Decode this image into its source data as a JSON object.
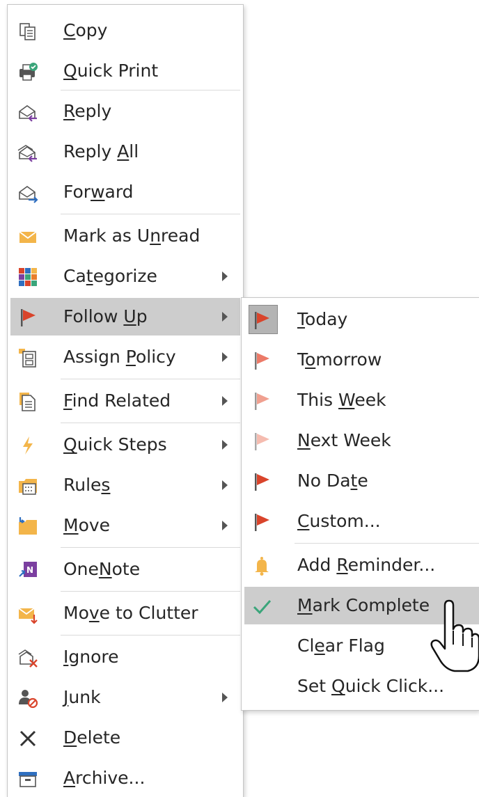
{
  "menu": {
    "items": [
      {
        "label": "Copy",
        "ul": 0,
        "icon": "copy-icon",
        "submenu": false,
        "highlighted": false
      },
      {
        "label": "Quick Print",
        "ul": 0,
        "icon": "quick-print-icon",
        "submenu": false,
        "highlighted": false
      },
      {
        "label": "Reply",
        "ul": 0,
        "icon": "reply-icon",
        "submenu": false,
        "highlighted": false
      },
      {
        "label": "Reply All",
        "ul": 6,
        "icon": "reply-all-icon",
        "submenu": false,
        "highlighted": false
      },
      {
        "label": "Forward",
        "ul": 3,
        "icon": "forward-icon",
        "submenu": false,
        "highlighted": false
      },
      {
        "label": "Mark as Unread",
        "ul": 9,
        "icon": "mark-unread-icon",
        "submenu": false,
        "highlighted": false
      },
      {
        "label": "Categorize",
        "ul": 2,
        "icon": "categorize-icon",
        "submenu": true,
        "highlighted": false
      },
      {
        "label": "Follow Up",
        "ul": 7,
        "icon": "follow-up-flag-icon",
        "submenu": true,
        "highlighted": true
      },
      {
        "label": "Assign Policy",
        "ul": 7,
        "icon": "assign-policy-icon",
        "submenu": true,
        "highlighted": false
      },
      {
        "label": "Find Related",
        "ul": 0,
        "icon": "find-related-icon",
        "submenu": true,
        "highlighted": false
      },
      {
        "label": "Quick Steps",
        "ul": 0,
        "icon": "quick-steps-icon",
        "submenu": true,
        "highlighted": false
      },
      {
        "label": "Rules",
        "ul": 4,
        "icon": "rules-icon",
        "submenu": true,
        "highlighted": false
      },
      {
        "label": "Move",
        "ul": 0,
        "icon": "move-icon",
        "submenu": true,
        "highlighted": false
      },
      {
        "label": "OneNote",
        "ul": 3,
        "icon": "onenote-icon",
        "submenu": false,
        "highlighted": false
      },
      {
        "label": "Move to Clutter",
        "ul": 2,
        "icon": "move-to-clutter-icon",
        "submenu": false,
        "highlighted": false
      },
      {
        "label": "Ignore",
        "ul": 0,
        "icon": "ignore-icon",
        "submenu": false,
        "highlighted": false
      },
      {
        "label": "Junk",
        "ul": 0,
        "icon": "junk-icon",
        "submenu": true,
        "highlighted": false
      },
      {
        "label": "Delete",
        "ul": 0,
        "icon": "delete-icon",
        "submenu": false,
        "highlighted": false
      },
      {
        "label": "Archive...",
        "ul": 0,
        "icon": "archive-icon",
        "submenu": false,
        "highlighted": false
      }
    ]
  },
  "submenu": {
    "items": [
      {
        "label": "Today",
        "ul": 0,
        "icon": "flag-today-icon",
        "highlighted": false
      },
      {
        "label": "Tomorrow",
        "ul": 1,
        "icon": "flag-tomorrow-icon",
        "highlighted": false
      },
      {
        "label": "This Week",
        "ul": 5,
        "icon": "flag-this-week-icon",
        "highlighted": false
      },
      {
        "label": "Next Week",
        "ul": 0,
        "icon": "flag-next-week-icon",
        "highlighted": false
      },
      {
        "label": "No Date",
        "ul": 5,
        "icon": "flag-no-date-icon",
        "highlighted": false
      },
      {
        "label": "Custom...",
        "ul": 0,
        "icon": "flag-custom-icon",
        "highlighted": false
      },
      {
        "label": "Add Reminder...",
        "ul": 4,
        "icon": "bell-icon",
        "highlighted": false
      },
      {
        "label": "Mark Complete",
        "ul": 0,
        "icon": "checkmark-icon",
        "highlighted": true
      },
      {
        "label": "Clear Flag",
        "ul": 2,
        "icon": "",
        "highlighted": false
      },
      {
        "label": "Set Quick Click...",
        "ul": 4,
        "icon": "",
        "highlighted": false
      }
    ]
  },
  "colors": {
    "highlight": "#cdcdcd",
    "flag_red": "#d9442b",
    "flag_light": "#f0a090",
    "check_green": "#3aa57a",
    "accent_purple": "#7b3fa0",
    "accent_blue": "#2f6fc0"
  }
}
